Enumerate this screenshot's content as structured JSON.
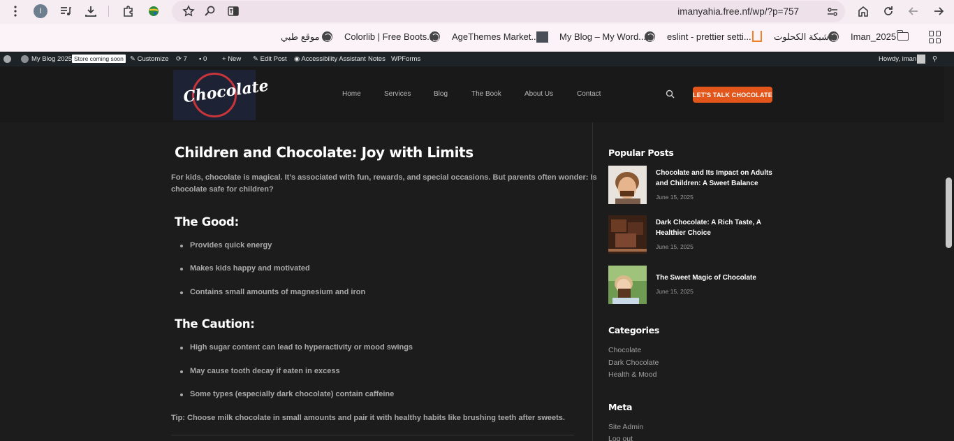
{
  "browser": {
    "profile_initial": "I",
    "url": "imanyahia.free.nf/wp/?p=757",
    "bookmarks": [
      {
        "label": "موقع طبي",
        "icon": "globe-icon"
      },
      {
        "label": "Colorlib | Free Boots...",
        "icon": "globe-icon"
      },
      {
        "label": "AgeThemes Market...",
        "icon": "agethemes-icon"
      },
      {
        "label": "My Blog – My Word...",
        "icon": "globe-icon"
      },
      {
        "label": "eslint - prettier setti...",
        "icon": "stackoverflow-icon"
      },
      {
        "label": "شبكة الكحلوت",
        "icon": "globe-icon"
      },
      {
        "label": "Iman_2025",
        "icon": "folder-icon"
      }
    ]
  },
  "admin_bar": {
    "site_name": "My Blog 2025",
    "store_badge": "Store coming soon",
    "customize": "Customize",
    "updates": "7",
    "comments": "0",
    "new": "New",
    "edit_post": "Edit Post",
    "accessibility": "Accessibility Assistant",
    "notes": "Notes",
    "wpforms": "WPForms",
    "howdy": "Howdy, iman"
  },
  "header": {
    "logo_text": "Chocolate",
    "nav": [
      "Home",
      "Services",
      "Blog",
      "The Book",
      "About Us",
      "Contact"
    ],
    "cta": "LET'S TALK CHOCOLATE"
  },
  "article": {
    "title": "Children and Chocolate: Joy with Limits",
    "intro_line1": "For kids, chocolate is magical. It’s associated with fun, rewards, and special occasions. But parents often wonder: Is",
    "intro_line2": "chocolate safe for children?",
    "good_heading": "The Good:",
    "good_items": [
      "Provides quick energy",
      "Makes kids happy and motivated",
      "Contains small amounts of magnesium and iron"
    ],
    "caution_heading": "The Caution:",
    "caution_items": [
      "High sugar content can lead to hyperactivity or mood swings",
      "May cause tooth decay if eaten in excess",
      "Some types (especially dark chocolate) contain caffeine"
    ],
    "tip": "Tip: Choose milk chocolate in small amounts and pair it with healthy habits like brushing teeth after sweets."
  },
  "sidebar": {
    "popular_heading": "Popular Posts",
    "posts": [
      {
        "title": "Chocolate and Its Impact on Adults and Children: A Sweet Balance",
        "date": "June 15, 2025"
      },
      {
        "title": "Dark Chocolate: A Rich Taste, A Healthier Choice",
        "date": "June 15, 2025"
      },
      {
        "title": "The Sweet Magic of Chocolate",
        "date": "June 15, 2025"
      }
    ],
    "categories_heading": "Categories",
    "categories": [
      "Chocolate",
      "Dark Chocolate",
      "Health & Mood"
    ],
    "meta_heading": "Meta",
    "meta_links": [
      "Site Admin",
      "Log out"
    ]
  }
}
